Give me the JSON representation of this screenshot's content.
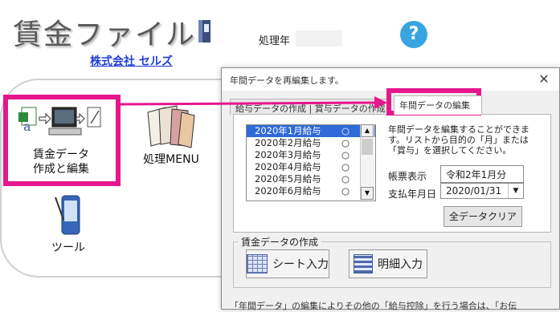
{
  "header": {
    "app_title": "賃金ファイル",
    "processing_year_label": "処理年",
    "processing_year_value": "",
    "company_link": "株式会社 セルズ",
    "help_symbol": "?"
  },
  "menu": {
    "wage_data": {
      "line1": "賃金データ",
      "line2": "作成と編集",
      "icon": "spreadsheet-computer-icon"
    },
    "processing_menu": {
      "label": "処理MENU",
      "icon": "books-icon"
    },
    "tools": {
      "label": "ツール",
      "icon": "pda-icon"
    }
  },
  "dialog": {
    "title": "年間データを再編集します。",
    "close_symbol": "✕",
    "tabs": [
      {
        "label": "給与データの作成 | 賞与データの作成",
        "active": false
      },
      {
        "label": "年間データの編集",
        "active": true
      }
    ],
    "month_list": [
      {
        "label": "2020年1月給与",
        "mark": "○",
        "selected": true
      },
      {
        "label": "2020年2月給与",
        "mark": "○",
        "selected": false
      },
      {
        "label": "2020年3月給与",
        "mark": "○",
        "selected": false
      },
      {
        "label": "2020年4月給与",
        "mark": "○",
        "selected": false
      },
      {
        "label": "2020年5月給与",
        "mark": "○",
        "selected": false
      },
      {
        "label": "2020年6月給与",
        "mark": "○",
        "selected": false
      }
    ],
    "description": "年間データを編集することができます。リストから目的の「月」または「賞与」を選択してください。",
    "ledger_display_label": "帳票表示",
    "ledger_display_value": "令和2年1月分",
    "pay_date_label": "支払年月日",
    "pay_date_value": "2020/01/31",
    "clear_all_button": "全データクリア",
    "group_title": "賃金データの作成",
    "sheet_input_button": "シート入力",
    "detail_input_button": "明細入力",
    "bottom_text": "「年間データ」の編集によりその他の「給与控除」を行う場合は、「お伝"
  },
  "colors": {
    "highlight": "#e6168c",
    "link": "#1f3fd8",
    "help": "#3aa4e0",
    "selection": "#2f6ad8"
  }
}
